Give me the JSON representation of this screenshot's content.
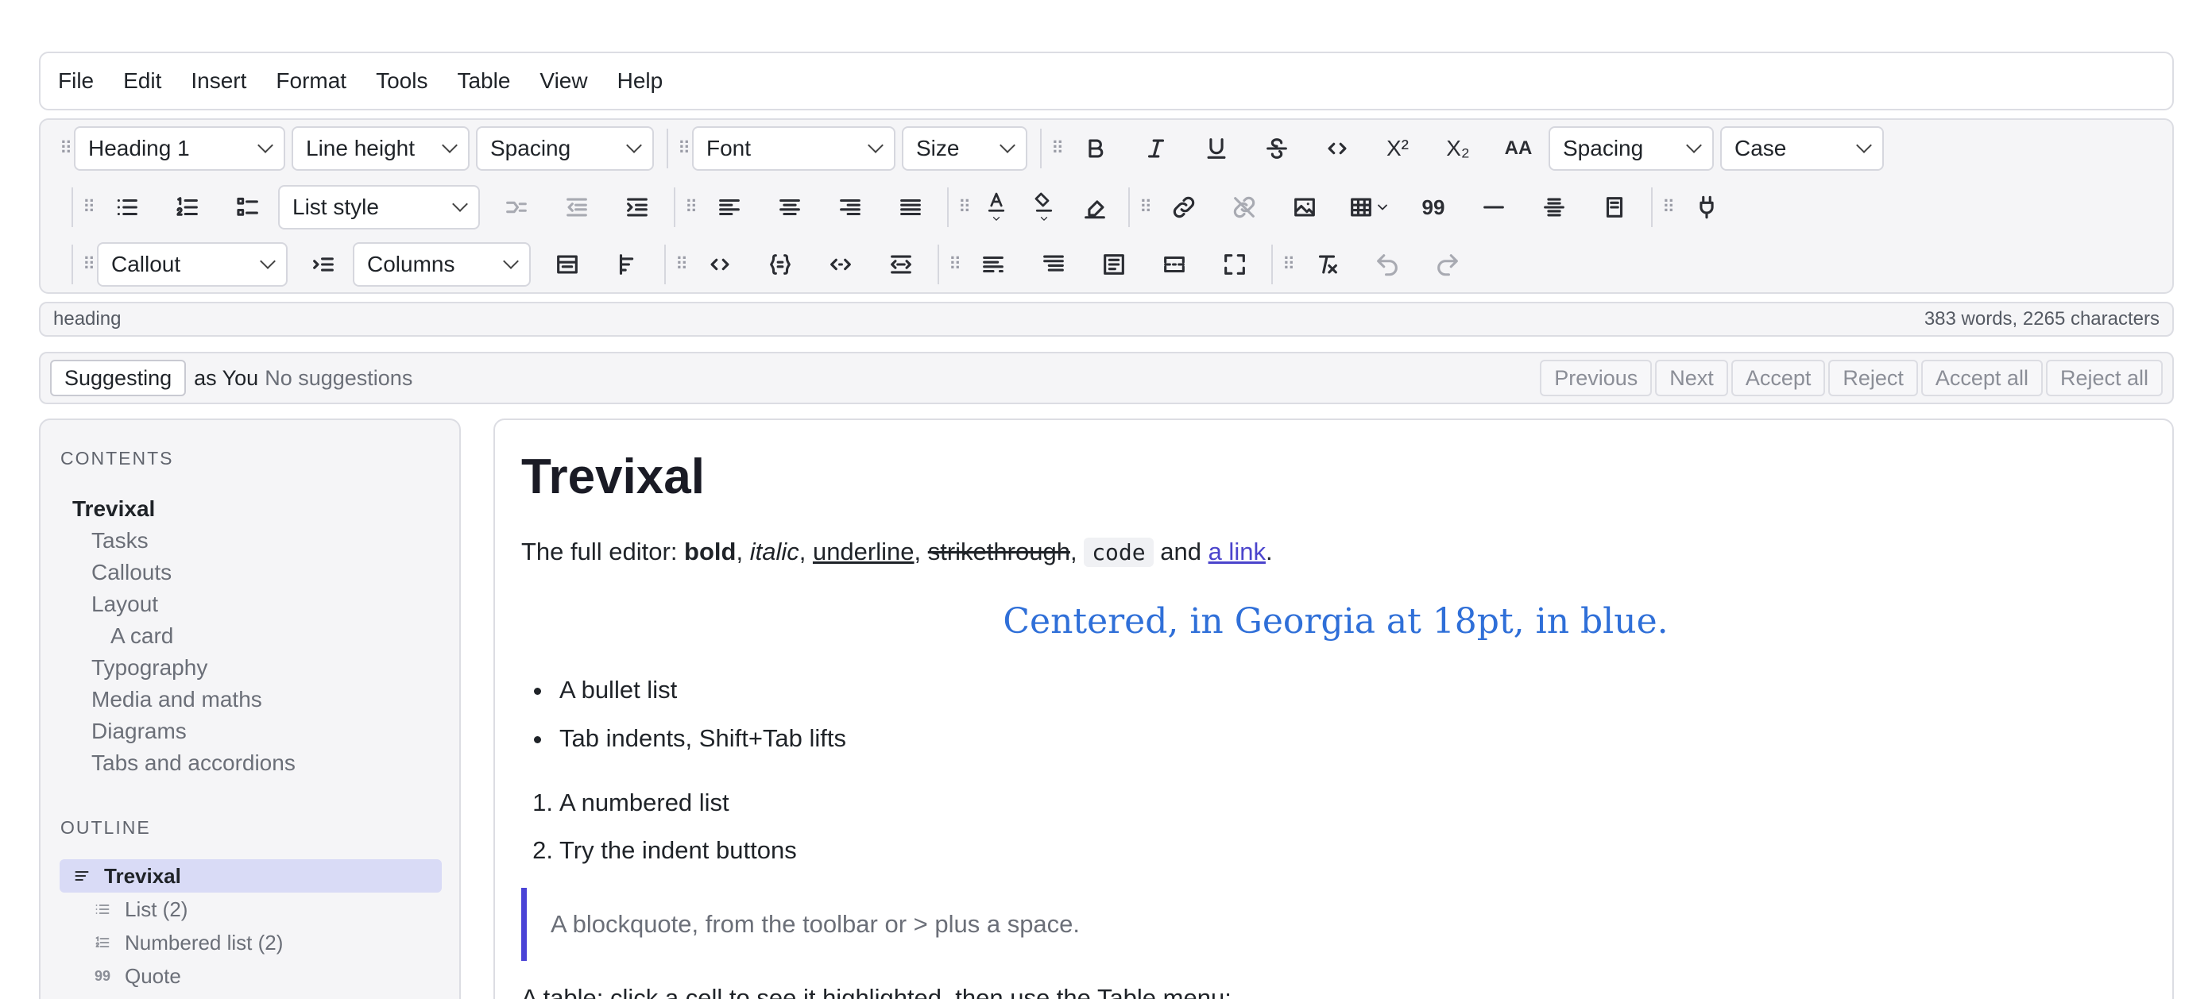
{
  "menu": [
    "File",
    "Edit",
    "Insert",
    "Format",
    "Tools",
    "Table",
    "View",
    "Help"
  ],
  "toolbar": {
    "block_style": "Heading 1",
    "line_height": "Line height",
    "spacing": "Spacing",
    "font": "Font",
    "size": "Size",
    "char_spacing": "Spacing",
    "case": "Case",
    "list_style": "List style",
    "callout": "Callout",
    "columns": "Columns",
    "superscript_label": "X²",
    "subscript_label": "X₂",
    "font_size_label": "AA",
    "quote_label": "99"
  },
  "status": {
    "node": "heading",
    "counts": "383 words, 2265 characters"
  },
  "suggest": {
    "mode": "Suggesting",
    "as_user": "as You",
    "none": "No suggestions",
    "buttons": [
      "Previous",
      "Next",
      "Accept",
      "Reject",
      "Accept all",
      "Reject all"
    ]
  },
  "sidebar": {
    "contents_title": "CONTENTS",
    "toc": [
      {
        "label": "Trevixal",
        "level": 0
      },
      {
        "label": "Tasks",
        "level": 1
      },
      {
        "label": "Callouts",
        "level": 1
      },
      {
        "label": "Layout",
        "level": 1
      },
      {
        "label": "A card",
        "level": 2
      },
      {
        "label": "Typography",
        "level": 1
      },
      {
        "label": "Media and maths",
        "level": 1
      },
      {
        "label": "Diagrams",
        "level": 1
      },
      {
        "label": "Tabs and accordions",
        "level": 1
      }
    ],
    "outline_title": "OUTLINE",
    "outline": [
      {
        "label": "Trevixal",
        "icon": "heading-icon"
      },
      {
        "label": "List (2)",
        "icon": "list-icon"
      },
      {
        "label": "Numbered list (2)",
        "icon": "numbered-list-icon"
      },
      {
        "label": "Quote",
        "icon": "quote-icon"
      }
    ]
  },
  "doc": {
    "title": "Trevixal",
    "intro_prefix": "The full editor: ",
    "bold": "bold",
    "comma1": ", ",
    "italic": "italic",
    "comma2": ", ",
    "underline": "underline",
    "comma3": ", ",
    "strike": "strikethrough",
    "comma4": ", ",
    "code": "code",
    "and": " and ",
    "link": "a link",
    "period": ".",
    "centered": "Centered, in Georgia at 18pt, in blue.",
    "bullets": [
      "A bullet list",
      "Tab indents, Shift+Tab lifts"
    ],
    "numbered": [
      "A numbered list",
      "Try the indent buttons"
    ],
    "numbers": [
      "1.",
      "2."
    ],
    "quote": "A blockquote, from the toolbar or > plus a space.",
    "table_intro": "A table: click a cell to see it highlighted, then use the Table menu:"
  }
}
